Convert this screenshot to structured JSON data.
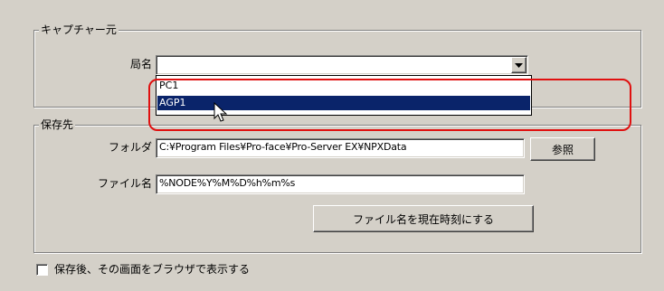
{
  "capture_source": {
    "group_title": "キャプチャー元",
    "station_label": "局名",
    "station_value": "",
    "station_options": [
      "PC1",
      "AGP1"
    ],
    "selected_option": "AGP1"
  },
  "destination": {
    "group_title": "保存先",
    "folder_label": "フォルダ",
    "folder_value": "C:¥Program Files¥Pro-face¥Pro-Server EX¥NPXData",
    "browse_button": "参照",
    "filename_label": "ファイル名",
    "filename_value": "%NODE%Y%M%D%h%m%s",
    "set_current_time_button": "ファイル名を現在時刻にする"
  },
  "options": {
    "show_in_browser_label": "保存後、その画面をブラウザで表示する",
    "show_in_browser_checked": false
  },
  "colors": {
    "selection": "#0a246a",
    "highlight_ring": "#e01010",
    "face": "#d4d0c8"
  }
}
